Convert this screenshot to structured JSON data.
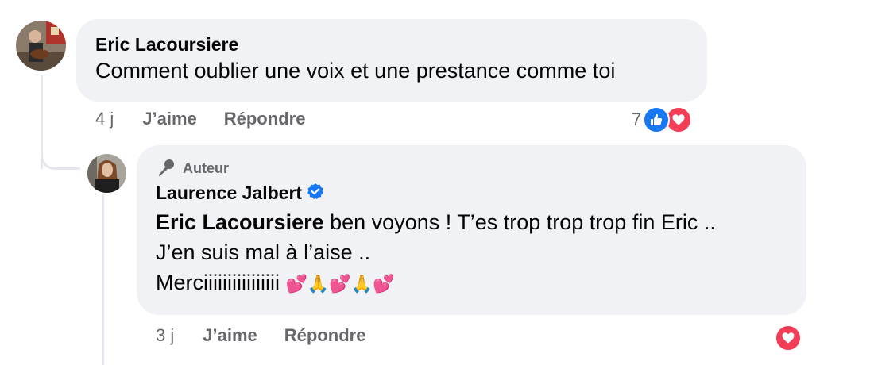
{
  "comment": {
    "author": "Eric Lacoursiere",
    "text": "Comment oublier une voix et une prestance comme toi",
    "time": "4 j",
    "like_label": "J’aime",
    "reply_label": "Répondre",
    "reaction_count": "7",
    "reactions": [
      "like-icon",
      "love-icon"
    ]
  },
  "reply": {
    "badge": "Auteur",
    "author": "Laurence Jalbert",
    "verified": true,
    "mention": "Eric Lacoursiere",
    "line1": " ben voyons ! T’es trop trop trop fin Eric ..",
    "line2": "J’en suis mal à l’aise ..",
    "line3": "Merciiiiiiiiiiiiiiii",
    "emojis": [
      "💕",
      "🙏",
      "💕",
      "🙏",
      "💕"
    ],
    "time": "3 j",
    "like_label": "J’aime",
    "reply_label": "Répondre",
    "reactions": [
      "love-icon"
    ]
  },
  "colors": {
    "bubble": "#f0f2f5",
    "meta": "#65676b",
    "like": "#1877f2",
    "love": "#f33e58",
    "verified": "#1877f2"
  }
}
